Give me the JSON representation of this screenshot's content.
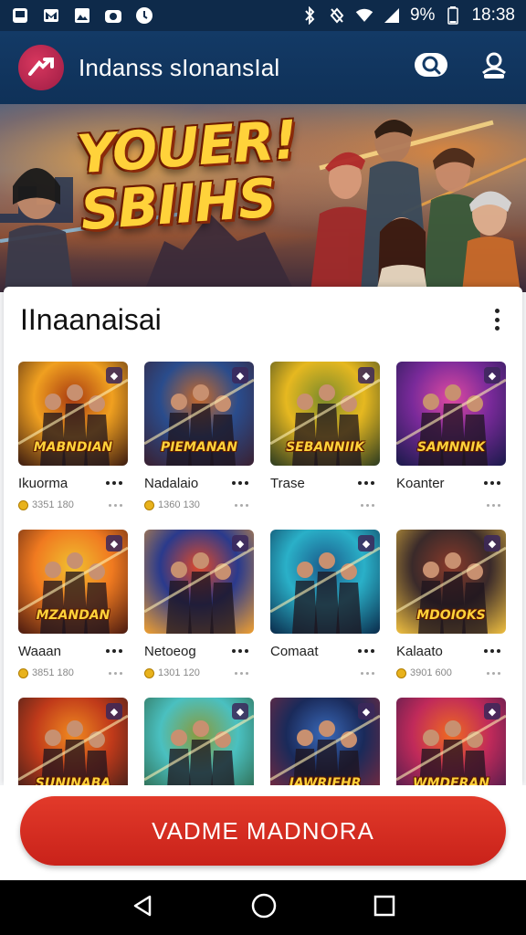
{
  "status_bar": {
    "battery": "9%",
    "time": "18:38"
  },
  "app_bar": {
    "title": "Indanss sIonansIal"
  },
  "banner": {
    "title_line1": "YOUER!",
    "title_line2": "SBIIHS"
  },
  "section": {
    "title": "IInaanaisai"
  },
  "games": [
    {
      "name": "Ikuorma",
      "meta": "3351 180",
      "thumb_text": "MABNDIAN",
      "palette": [
        "#f0a020",
        "#a83a10",
        "#3a1a10"
      ]
    },
    {
      "name": "Nadalaio",
      "meta": "1360 130",
      "thumb_text": "PIEMANAN",
      "palette": [
        "#2a4c8c",
        "#c86a2a",
        "#3a2030"
      ]
    },
    {
      "name": "Trase",
      "meta": "",
      "thumb_text": "SEBANNIIK",
      "palette": [
        "#e6b820",
        "#7a8a2a",
        "#2a3a20"
      ]
    },
    {
      "name": "Koanter",
      "meta": "",
      "thumb_text": "SAMNNIK",
      "palette": [
        "#7a2a9a",
        "#e04aa0",
        "#1a1a4a"
      ]
    },
    {
      "name": "Waaan",
      "meta": "3851 180",
      "thumb_text": "MZANDAN",
      "palette": [
        "#f07a20",
        "#f0c030",
        "#4a1a10"
      ]
    },
    {
      "name": "Netoeog",
      "meta": "1301 120",
      "thumb_text": "",
      "palette": [
        "#2a3a8c",
        "#e04a2a",
        "#f0a030"
      ]
    },
    {
      "name": "Comaat",
      "meta": "",
      "thumb_text": "",
      "palette": [
        "#2ab0c8",
        "#1a5a8a",
        "#0a2a4a"
      ]
    },
    {
      "name": "Kalaato",
      "meta": "3901 600",
      "thumb_text": "MDOIOKS",
      "palette": [
        "#3a2a2a",
        "#8a3a2a",
        "#f0c040"
      ]
    },
    {
      "name": "",
      "meta": "",
      "thumb_text": "SUNINABA",
      "palette": [
        "#c03a1a",
        "#f08a20",
        "#2a1a1a"
      ]
    },
    {
      "name": "",
      "meta": "",
      "thumb_text": "",
      "palette": [
        "#4ac0c0",
        "#8a9a3a",
        "#2a5a3a"
      ]
    },
    {
      "name": "",
      "meta": "",
      "thumb_text": "JAWRIEHR",
      "palette": [
        "#1a2a5a",
        "#3a6aba",
        "#8a2a3a"
      ]
    },
    {
      "name": "",
      "meta": "",
      "thumb_text": "WMDERAN",
      "palette": [
        "#c02a5a",
        "#f06a20",
        "#3a1a4a"
      ]
    }
  ],
  "cta": {
    "label": "VADME MADNORA"
  },
  "icons": {
    "status_left": [
      "notification-icon",
      "gmail-icon",
      "image-icon",
      "camera-icon",
      "whatsapp-icon"
    ],
    "status_right": [
      "bluetooth-icon",
      "mute-icon",
      "wifi-icon",
      "signal-icon",
      "battery-icon"
    ],
    "app_bar": [
      "search-icon",
      "profile-icon"
    ],
    "nav": [
      "back-icon",
      "home-icon",
      "recents-icon"
    ]
  },
  "colors": {
    "app_bar": "#133a66",
    "status_bar": "#0e2a4a",
    "cta": "#d52c20",
    "badge_gold": "#e8b21c"
  }
}
